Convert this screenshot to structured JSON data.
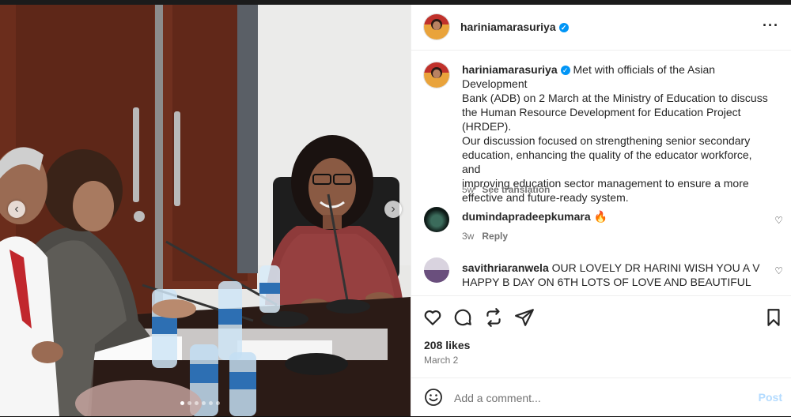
{
  "post": {
    "username": "hariniamarasuriya",
    "verified_icon": "verified-badge-icon",
    "caption_lines": [
      "Met with officials of the Asian Development",
      "Bank (ADB) on 2 March at the Ministry of Education to discuss",
      "the Human Resource Development for Education Project",
      "(HRDEP).",
      "Our discussion focused on strengthening senior secondary",
      "education, enhancing the quality of the educator workforce, and",
      "improving education sector management to ensure a more",
      "effective and future-ready system."
    ],
    "caption_age": "5w",
    "see_translation": "See translation",
    "likes": "208 likes",
    "date": "March 2"
  },
  "comments": [
    {
      "username": "dumindapradeepkumara",
      "text": "🔥",
      "age": "3w",
      "reply": "Reply"
    },
    {
      "username": "savithriaranwela",
      "text": "OUR LOVELY DR HARINI WISH YOU A V",
      "text2": "HAPPY B DAY ON 6TH LOTS OF LOVE AND BEAUTIFUL"
    }
  ],
  "comment_box": {
    "placeholder": "Add a comment...",
    "post_label": "Post"
  },
  "colors": {
    "accent": "#0095f6",
    "post_disabled": "#b3dbff",
    "muted": "#737373"
  },
  "photo": {
    "current_slide": 1,
    "total_slides": 6
  }
}
